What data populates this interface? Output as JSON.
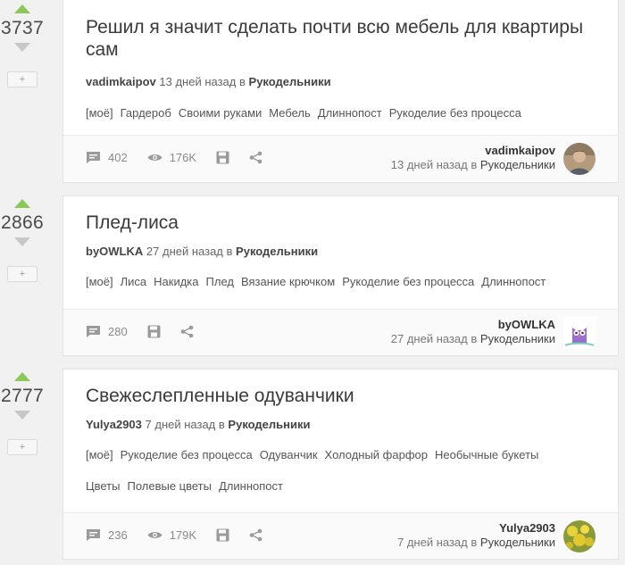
{
  "posts": [
    {
      "rating": "3737",
      "save_label": "+",
      "title": "Решил я значит сделать почти всю мебель для квартиры сам",
      "author": "vadimkaipov",
      "time": "13 дней назад",
      "in": "в",
      "community": "Рукодельники",
      "tags_row1": [
        "[моё]",
        "Гардероб",
        "Своими руками",
        "Мебель",
        "Длиннопост",
        "Рукоделие без процесса"
      ],
      "tags_row2": [],
      "comments": "402",
      "views": "176K",
      "avatar_icon": "avatar-photo"
    },
    {
      "rating": "2866",
      "save_label": "+",
      "title": "Плед-лиса",
      "author": "byOWLKA",
      "time": "27 дней назад",
      "in": "в",
      "community": "Рукодельники",
      "tags_row1": [
        "[моё]",
        "Лиса",
        "Накидка",
        "Плед",
        "Вязание крючком",
        "Рукоделие без процесса",
        "Длиннопост"
      ],
      "tags_row2": [],
      "comments": "280",
      "views": "",
      "avatar_icon": "owl-avatar"
    },
    {
      "rating": "2777",
      "save_label": "+",
      "title": "Свежеслепленные одуванчики",
      "author": "Yulya2903",
      "time": "7 дней назад",
      "in": "в",
      "community": "Рукодельники",
      "tags_row1": [
        "[моё]",
        "Рукоделие без процесса",
        "Одуванчик",
        "Холодный фарфор",
        "Необычные букеты"
      ],
      "tags_row2": [
        "Цветы",
        "Полевые цветы",
        "Длиннопост"
      ],
      "comments": "236",
      "views": "179K",
      "avatar_icon": "flowers-avatar"
    }
  ],
  "colors": {
    "upvote": "#8ac858",
    "downvote": "#c7c7c7",
    "background": "#f1f1f1",
    "card": "#ffffff"
  }
}
